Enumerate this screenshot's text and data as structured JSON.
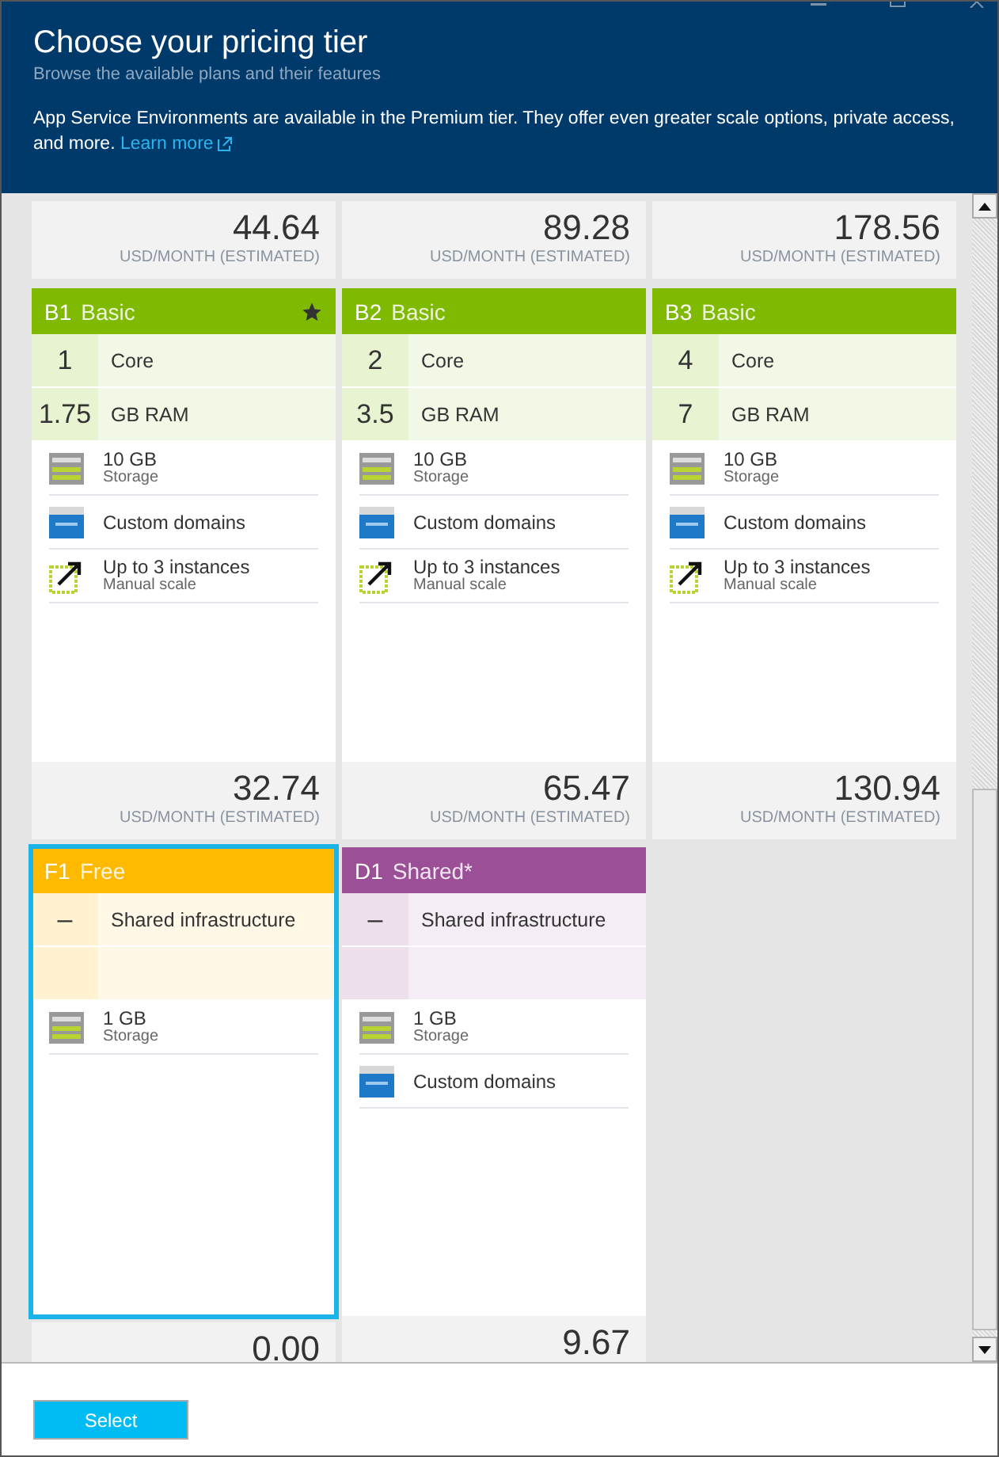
{
  "header": {
    "title": "Choose your pricing tier",
    "subtitle": "Browse the available plans and their features",
    "notice": "App Service Environments are available in the Premium tier. They offer even greater scale options, private access, and more.",
    "link": "Learn more"
  },
  "top_prices": [
    {
      "price": "44.64",
      "unit": "USD/MONTH (ESTIMATED)"
    },
    {
      "price": "89.28",
      "unit": "USD/MONTH (ESTIMATED)"
    },
    {
      "price": "178.56",
      "unit": "USD/MONTH (ESTIMATED)"
    }
  ],
  "cards": [
    {
      "code": "B1",
      "name": "Basic",
      "color": "#7fba00",
      "starred": true,
      "selected": false,
      "specs": [
        {
          "value": "1",
          "label": "Core"
        },
        {
          "value": "1.75",
          "label": "GB RAM"
        }
      ],
      "features": [
        {
          "kind": "storage",
          "title": "10 GB",
          "subtitle": "Storage"
        },
        {
          "kind": "domains",
          "title": "Custom domains"
        },
        {
          "kind": "scale",
          "title": "Up to 3 instances",
          "subtitle": "Manual scale"
        }
      ],
      "price": "32.74",
      "unit": "USD/MONTH (ESTIMATED)"
    },
    {
      "code": "B2",
      "name": "Basic",
      "color": "#7fba00",
      "starred": false,
      "selected": false,
      "specs": [
        {
          "value": "2",
          "label": "Core"
        },
        {
          "value": "3.5",
          "label": "GB RAM"
        }
      ],
      "features": [
        {
          "kind": "storage",
          "title": "10 GB",
          "subtitle": "Storage"
        },
        {
          "kind": "domains",
          "title": "Custom domains"
        },
        {
          "kind": "scale",
          "title": "Up to 3 instances",
          "subtitle": "Manual scale"
        }
      ],
      "price": "65.47",
      "unit": "USD/MONTH (ESTIMATED)"
    },
    {
      "code": "B3",
      "name": "Basic",
      "color": "#7fba00",
      "starred": false,
      "selected": false,
      "specs": [
        {
          "value": "4",
          "label": "Core"
        },
        {
          "value": "7",
          "label": "GB RAM"
        }
      ],
      "features": [
        {
          "kind": "storage",
          "title": "10 GB",
          "subtitle": "Storage"
        },
        {
          "kind": "domains",
          "title": "Custom domains"
        },
        {
          "kind": "scale",
          "title": "Up to 3 instances",
          "subtitle": "Manual scale"
        }
      ],
      "price": "130.94",
      "unit": "USD/MONTH (ESTIMATED)"
    },
    {
      "code": "F1",
      "name": "Free",
      "color": "#ffb900",
      "starred": false,
      "selected": true,
      "specs": [
        {
          "value": "–",
          "label": "Shared infrastructure"
        }
      ],
      "features": [
        {
          "kind": "storage",
          "title": "1 GB",
          "subtitle": "Storage"
        }
      ],
      "price": "0.00"
    },
    {
      "code": "D1",
      "name": "Shared*",
      "color": "#9b4f96",
      "starred": false,
      "selected": false,
      "specs": [
        {
          "value": "–",
          "label": "Shared infrastructure"
        }
      ],
      "features": [
        {
          "kind": "storage",
          "title": "1 GB",
          "subtitle": "Storage"
        },
        {
          "kind": "domains",
          "title": "Custom domains"
        }
      ],
      "price": "9.67"
    }
  ],
  "footer": {
    "button": "Select"
  }
}
